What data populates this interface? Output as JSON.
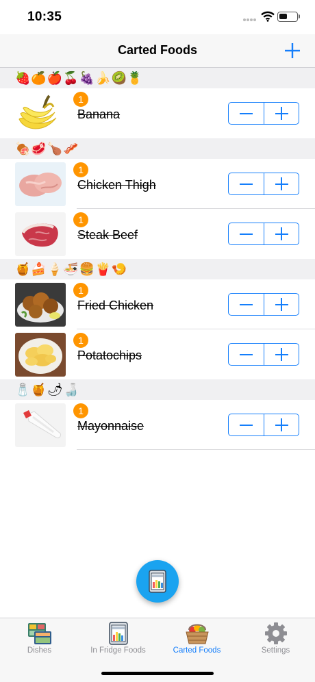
{
  "status_bar": {
    "time": "10:35"
  },
  "nav": {
    "title": "Carted Foods",
    "add_icon": "plus-icon"
  },
  "sections": [
    {
      "emojis": "🍓🍊🍎🍒🍇🍌🥝🍍",
      "items": [
        {
          "name": "Banana",
          "count": "1",
          "image": "banana"
        }
      ]
    },
    {
      "emojis": "🍖🥩🍗🥓",
      "items": [
        {
          "name": "Chicken Thigh",
          "count": "1",
          "image": "chicken-thigh"
        },
        {
          "name": "Steak Beef",
          "count": "1",
          "image": "steak-beef"
        }
      ]
    },
    {
      "emojis": "🍯🍰🍦🍜🍔🍟🍤",
      "items": [
        {
          "name": "Fried Chicken",
          "count": "1",
          "image": "fried-chicken"
        },
        {
          "name": "Potatochips",
          "count": "1",
          "image": "potatochips"
        }
      ]
    },
    {
      "emojis": "🧂🍯🌶🍶",
      "items": [
        {
          "name": "Mayonnaise",
          "count": "1",
          "image": "mayonnaise"
        }
      ]
    }
  ],
  "fab": {
    "icon": "fridge-icon"
  },
  "tabs": [
    {
      "label": "Dishes",
      "icon": "dishes-icon",
      "active": false
    },
    {
      "label": "In Fridge Foods",
      "icon": "fridge-foods-icon",
      "active": false
    },
    {
      "label": "Carted Foods",
      "icon": "basket-icon",
      "active": true
    },
    {
      "label": "Settings",
      "icon": "gear-icon",
      "active": false
    }
  ],
  "colors": {
    "accent": "#147efb",
    "badge": "#ff9500",
    "fab": "#1aa3f0"
  }
}
